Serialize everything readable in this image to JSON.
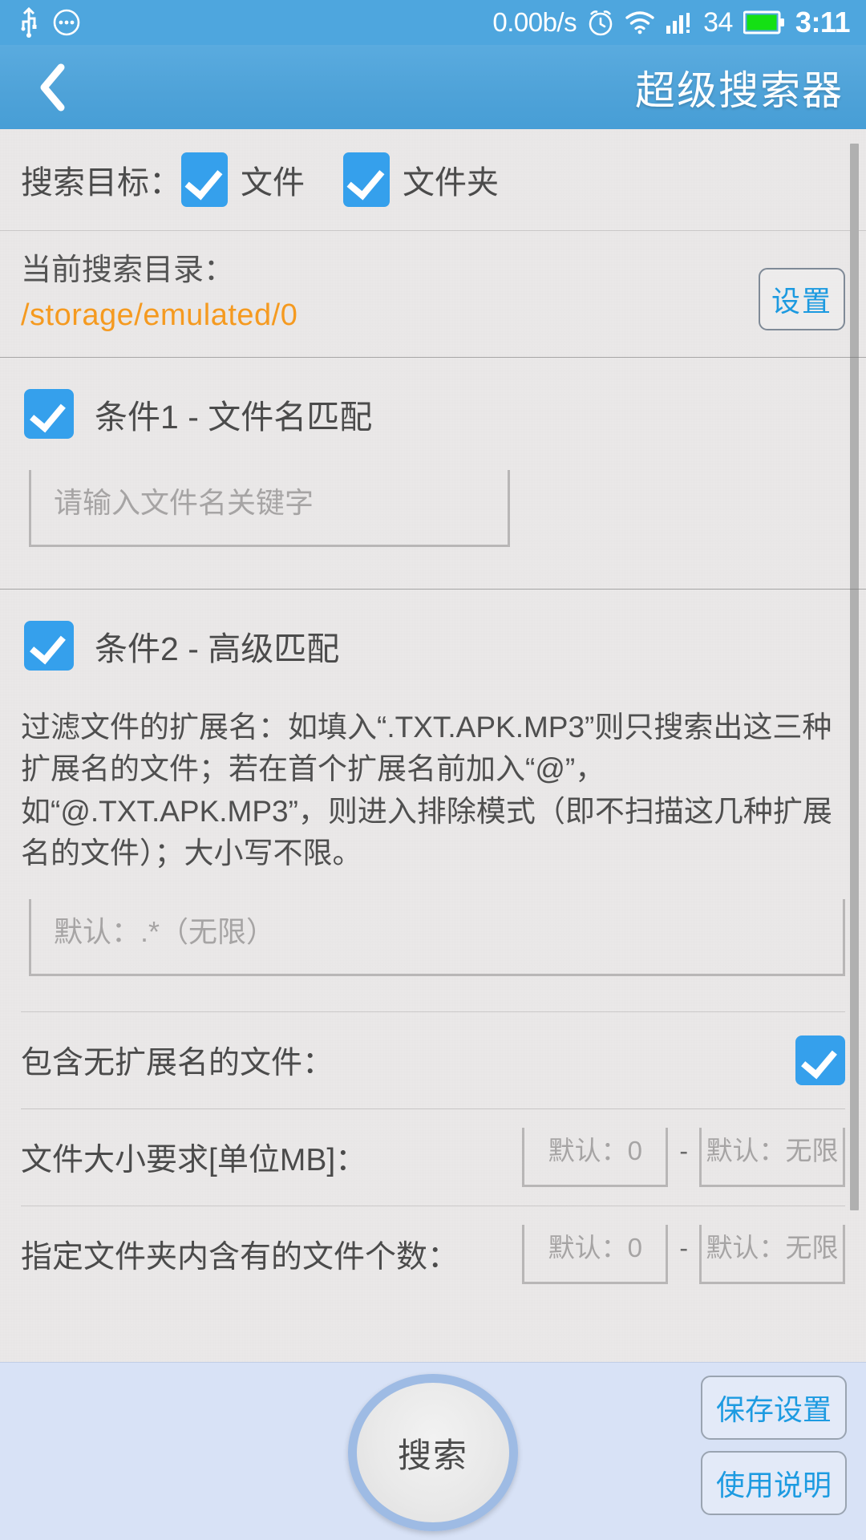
{
  "statusbar": {
    "usb_icon": "usb-icon",
    "dots_icon": "more-dots-icon",
    "network_speed": "0.00b/s",
    "alarm_icon": "alarm-clock-icon",
    "wifi_icon": "wifi-icon",
    "signal_icon": "cellular-signal-icon",
    "battery_percent": "34",
    "battery_icon": "battery-full-icon",
    "time": "3:11"
  },
  "titlebar": {
    "back_icon": "back-chevron-icon",
    "title": "超级搜索器"
  },
  "search_target": {
    "label": "搜索目标：",
    "options": [
      {
        "label": "文件",
        "checked": true
      },
      {
        "label": "文件夹",
        "checked": true
      }
    ]
  },
  "current_dir": {
    "label": "当前搜索目录：",
    "path": "/storage/emulated/0",
    "settings_button": "设置"
  },
  "condition1": {
    "title": "条件1 - 文件名匹配",
    "checked": true,
    "input_placeholder": "请输入文件名关键字",
    "input_value": ""
  },
  "condition2": {
    "title": "条件2 - 高级匹配",
    "checked": true,
    "description": "过滤文件的扩展名：如填入“.TXT.APK.MP3”则只搜索出这三种扩展名的文件；若在首个扩展名前加入“@”，如“@.TXT.APK.MP3”，则进入排除模式（即不扫描这几种扩展名的文件）；大小写不限。",
    "ext_placeholder": "默认：.*（无限）",
    "ext_value": "",
    "include_no_ext": {
      "label": "包含无扩展名的文件：",
      "checked": true
    },
    "file_size": {
      "label": "文件大小要求[单位MB]：",
      "min_placeholder": "默认：0",
      "max_placeholder": "默认：无限",
      "separator": "-"
    },
    "folder_count": {
      "label": "指定文件夹内含有的文件个数：",
      "min_placeholder": "默认：0",
      "max_placeholder": "默认：无限",
      "separator": "-"
    }
  },
  "bottombar": {
    "search_button": "搜索",
    "save_settings_button": "保存设置",
    "help_button": "使用说明"
  },
  "colors": {
    "accent_blue": "#4ea6de",
    "checkbox_blue": "#35a0ec",
    "path_orange": "#f59a20",
    "link_blue": "#1c9ae0",
    "bottom_bar": "#d8e2f6"
  }
}
